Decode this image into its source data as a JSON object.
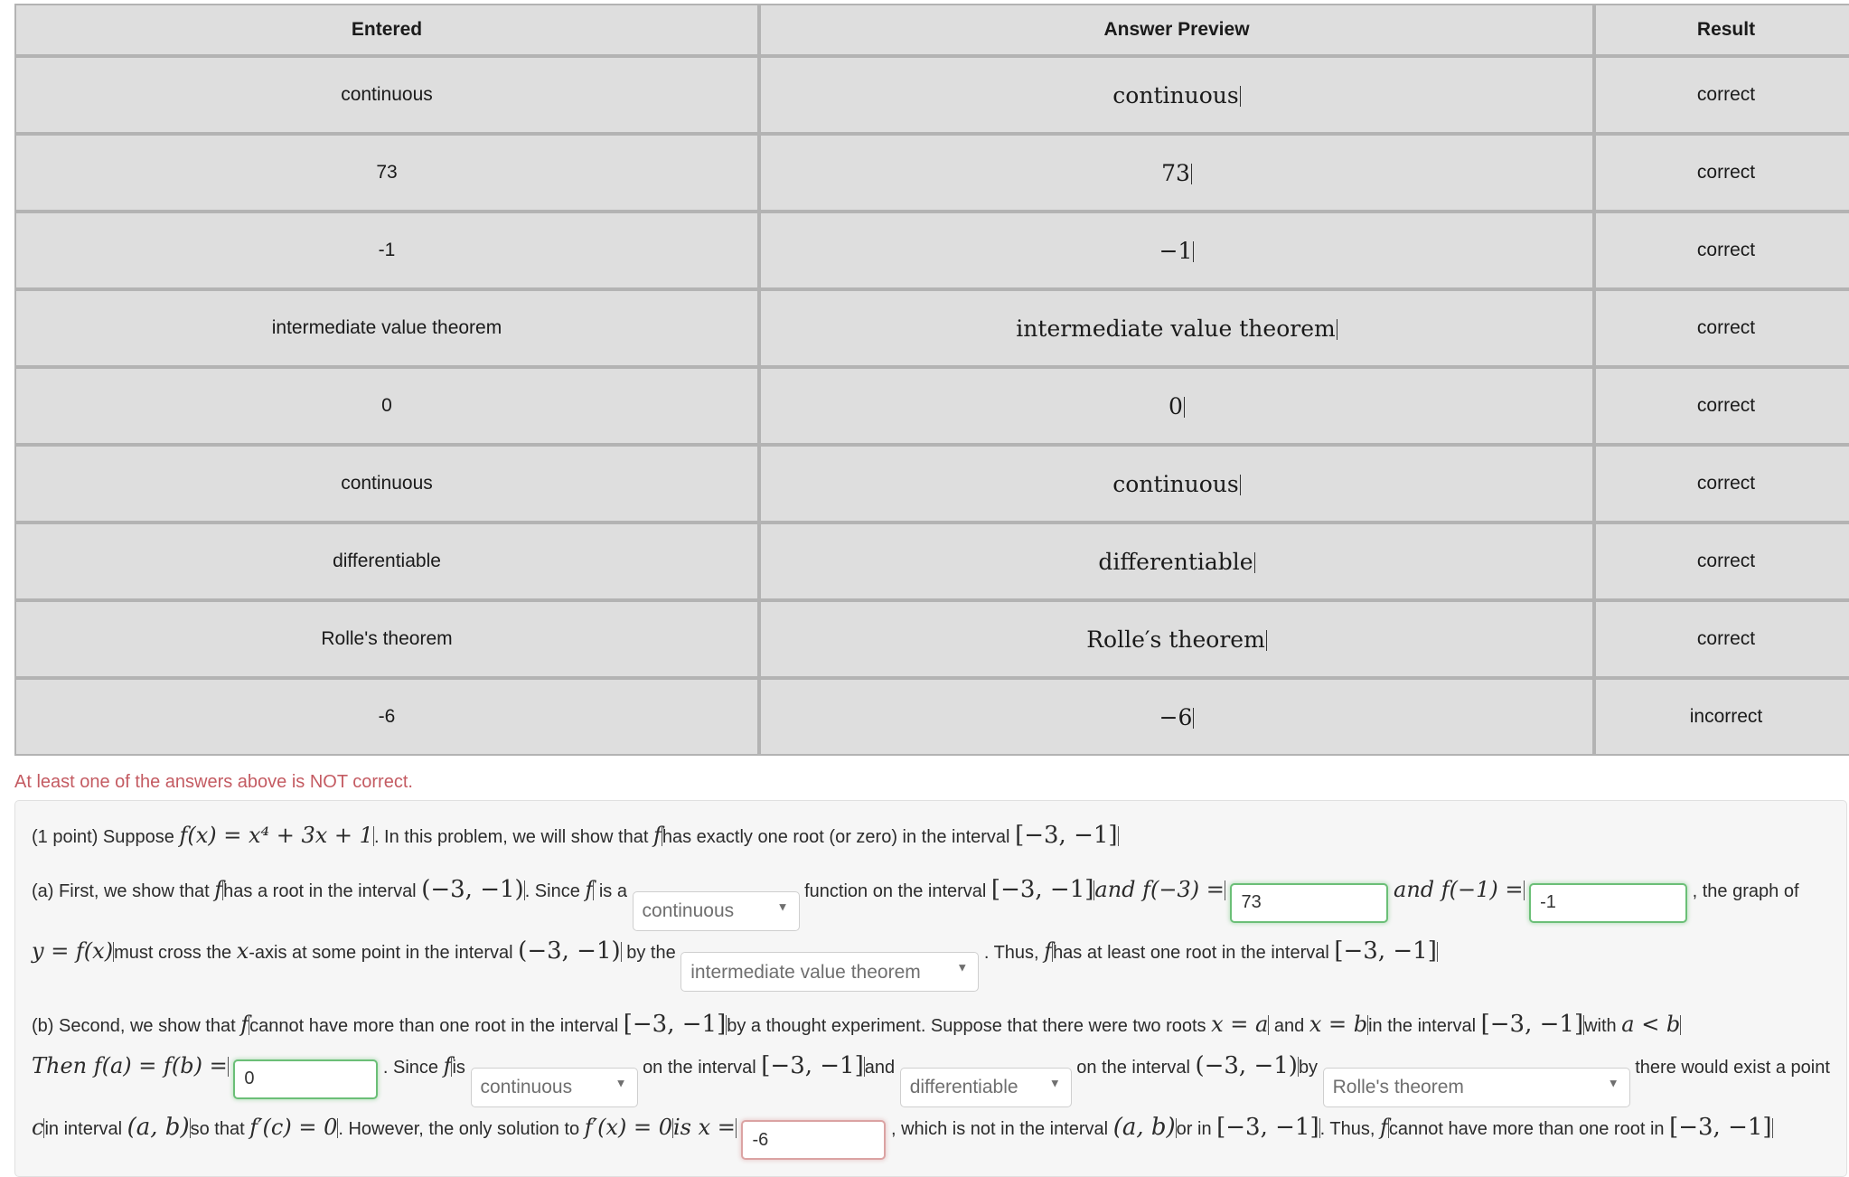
{
  "results_table": {
    "headers": [
      "Entered",
      "Answer Preview",
      "Result"
    ],
    "rows": [
      {
        "entered": "continuous",
        "preview": "continuous",
        "result": "correct"
      },
      {
        "entered": "73",
        "preview": "73",
        "result": "correct"
      },
      {
        "entered": "-1",
        "preview": "−1",
        "result": "correct"
      },
      {
        "entered": "intermediate value theorem",
        "preview": "intermediate value theorem",
        "result": "correct"
      },
      {
        "entered": "0",
        "preview": "0",
        "result": "correct"
      },
      {
        "entered": "continuous",
        "preview": "continuous",
        "result": "correct"
      },
      {
        "entered": "differentiable",
        "preview": "differentiable",
        "result": "correct"
      },
      {
        "entered": "Rolle's theorem",
        "preview": "Rolle′s theorem",
        "result": "correct"
      },
      {
        "entered": "-6",
        "preview": "−6",
        "result": "incorrect"
      }
    ]
  },
  "warning": "At least one of the answers above is NOT correct.",
  "problem": {
    "points_label": "(1 point) Suppose",
    "fx_def": "f(x) = x⁴ + 3x + 1",
    "intro_mid": ". In this problem, we will show that",
    "f_sym": "f",
    "intro_tail": "has exactly one root (or zero) in the interval",
    "interval_closed": "[−3, −1]",
    "interval_open": "(−3, −1)",
    "part_a": {
      "lead": "(a) First, we show that",
      "lead2": "has a root in the interval",
      "since": ". Since",
      "is_a": "is a",
      "select_continuous": "continuous",
      "function_on": "function on the interval",
      "and_f3": "and f(−3) =",
      "value_73": "73",
      "and_fm1": "and f(−1) =",
      "value_m1": "-1",
      "the_comma": ", the",
      "graph_of": "graph of",
      "y_eq_fx": "y = f(x)",
      "must_cross": "must cross the",
      "x_axis": "x",
      "axis_word": "-axis at some point in the interval",
      "by_the": "by the",
      "select_ivt": "intermediate value theorem",
      "thus": ". Thus,",
      "at_least": "has at least one root in the interval"
    },
    "part_b": {
      "lead": "(b) Second, we show that",
      "cannot_have": "cannot have more than one root in the interval",
      "thought_exp": "by a thought experiment. Suppose that there were two roots",
      "x_eq_a": "x = a",
      "and_word": "and",
      "x_eq_b": "x = b",
      "in_interval": "in the interval",
      "with_word": "with",
      "a_lt_b": "a < b",
      "then_fa_fb": "Then f(a) = f(b) =",
      "value_0": "0",
      "since_f": ". Since",
      "is_word": "is",
      "select_continuous": "continuous",
      "on_interval": "on the interval",
      "and2": "and",
      "select_differentiable": "differentiable",
      "on_interval2": "on the interval",
      "by_word": "by",
      "select_rolle": "Rolle's theorem",
      "there": "there",
      "would_exist": "would exist a point",
      "c_sym": "c",
      "in_interval_ab": "in interval",
      "ab_open": "(a, b)",
      "so_that": "so that",
      "fp_c_zero": "f′(c) = 0",
      "however": ". However, the only solution to",
      "fp_x_zero": "f′(x) = 0",
      "is_x_eq": "is x =",
      "value_m6": "-6",
      "which_not": ", which is not in the interval",
      "or_in": "or in",
      "thus_f": ". Thus,",
      "cannot_have2": "cannot have",
      "more_than": "more than one root in"
    }
  },
  "colors": {
    "correct_bg": "#82f982",
    "incorrect_bg": "#d99a9d",
    "result_text": "#23239c",
    "cell_bg": "#dedede",
    "warning_text": "#c45b62",
    "input_ok_border": "#6bbf77",
    "input_bad_border": "#dba3a3"
  }
}
